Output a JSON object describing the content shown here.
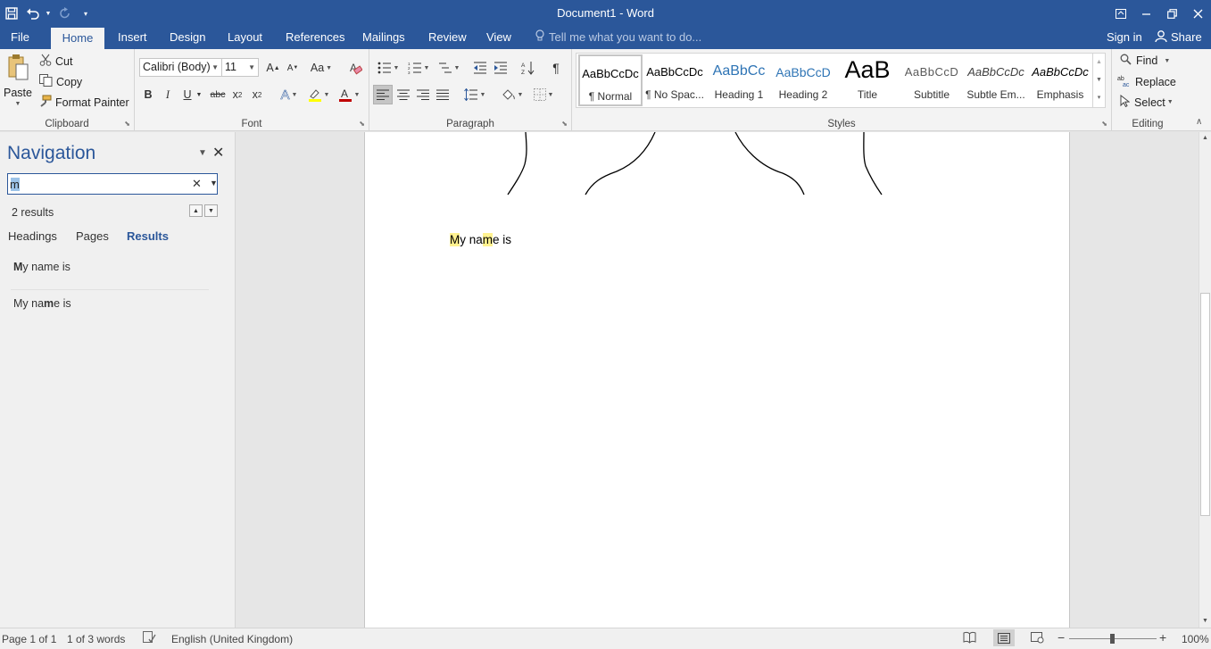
{
  "window": {
    "title": "Document1 - Word",
    "controls": [
      "ribbon-display-icon",
      "minimize-icon",
      "restore-icon",
      "close-icon"
    ]
  },
  "qat": {
    "items": [
      "save-icon",
      "undo-icon",
      "redo-icon",
      "customize-icon"
    ]
  },
  "tabs": [
    "File",
    "Home",
    "Insert",
    "Design",
    "Layout",
    "References",
    "Mailings",
    "Review",
    "View"
  ],
  "active_tab": "Home",
  "tell_me": "Tell me what you want to do...",
  "sign_in": "Sign in",
  "share": "Share",
  "clipboard": {
    "paste": "Paste",
    "cut": "Cut",
    "copy": "Copy",
    "format_painter": "Format Painter",
    "label": "Clipboard"
  },
  "font": {
    "name": "Calibri (Body)",
    "size": "11",
    "label": "Font",
    "font_color": "#c00000",
    "highlight_color": "#ffff00"
  },
  "paragraph": {
    "label": "Paragraph"
  },
  "styles": {
    "label": "Styles",
    "items": [
      {
        "preview": "AaBbCcDc",
        "name": "¶ Normal"
      },
      {
        "preview": "AaBbCcDc",
        "name": "¶ No Spac..."
      },
      {
        "preview": "AaBbCc",
        "name": "Heading 1"
      },
      {
        "preview": "AaBbCcD",
        "name": "Heading 2"
      },
      {
        "preview": "AaB",
        "name": "Title"
      },
      {
        "preview": "AaBbCcD",
        "name": "Subtitle"
      },
      {
        "preview": "AaBbCcDc",
        "name": "Subtle Em..."
      },
      {
        "preview": "AaBbCcDc",
        "name": "Emphasis"
      }
    ]
  },
  "editing": {
    "find": "Find",
    "replace": "Replace",
    "select": "Select",
    "label": "Editing"
  },
  "navigation": {
    "title": "Navigation",
    "search_value": "m",
    "result_count": "2 results",
    "tabs": [
      "Headings",
      "Pages",
      "Results"
    ],
    "active_tab": "Results",
    "results": [
      {
        "before": "",
        "match": "M",
        "after": "y name is"
      },
      {
        "before": "My na",
        "match": "m",
        "after": "e is"
      }
    ]
  },
  "document": {
    "text_parts": [
      {
        "text": "M",
        "highlight": true
      },
      {
        "text": "y na",
        "highlight": false
      },
      {
        "text": "m",
        "highlight": true
      },
      {
        "text": "e is",
        "highlight": false
      }
    ]
  },
  "status": {
    "page": "Page 1 of 1",
    "words": "1 of 3 words",
    "language": "English (United Kingdom)",
    "zoom": "100%"
  },
  "colors": {
    "brand": "#2b579a",
    "search_highlight": "#fff28f"
  }
}
